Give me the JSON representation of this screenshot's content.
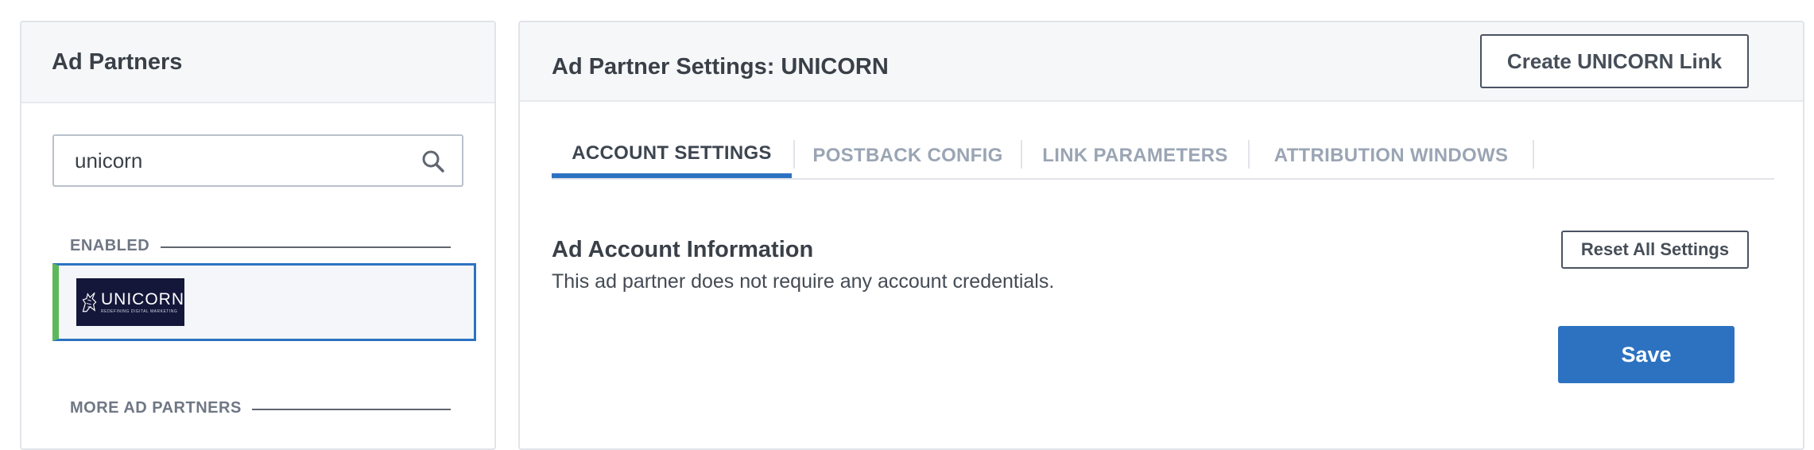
{
  "left_panel": {
    "title": "Ad Partners",
    "search": {
      "value": "unicorn",
      "icon": "search-icon"
    },
    "enabled_label": "ENABLED",
    "more_label": "MORE AD PARTNERS",
    "partners": [
      {
        "name": "UNICORN",
        "tagline": "REDEFINING DIGITAL MARKETING",
        "status_color": "#5cb85c"
      }
    ]
  },
  "right_panel": {
    "title": "Ad Partner Settings: UNICORN",
    "create_link_label": "Create UNICORN Link",
    "tabs": [
      {
        "label": "ACCOUNT SETTINGS",
        "active": true
      },
      {
        "label": "POSTBACK CONFIG",
        "active": false
      },
      {
        "label": "LINK PARAMETERS",
        "active": false
      },
      {
        "label": "ATTRIBUTION WINDOWS",
        "active": false
      }
    ],
    "section": {
      "heading": "Ad Account Information",
      "description": "This ad partner does not require any account credentials."
    },
    "reset_label": "Reset All Settings",
    "save_label": "Save"
  },
  "colors": {
    "accent": "#2d72c1",
    "enabled": "#5cb85c",
    "logo_bg": "#14173a"
  }
}
